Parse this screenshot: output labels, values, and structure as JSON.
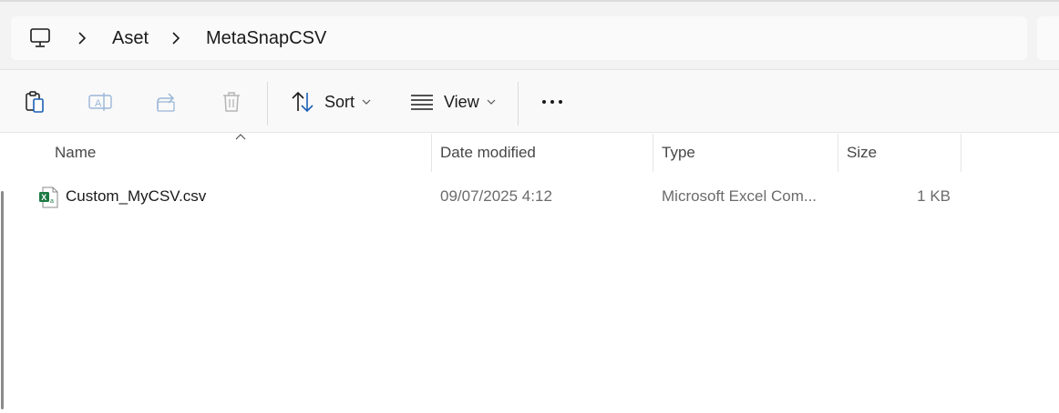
{
  "breadcrumb": {
    "items": [
      "Aset",
      "MetaSnapCSV"
    ]
  },
  "toolbar": {
    "sort_label": "Sort",
    "view_label": "View"
  },
  "columns": {
    "name": "Name",
    "date": "Date modified",
    "type": "Type",
    "size": "Size"
  },
  "files": [
    {
      "name": "Custom_MyCSV.csv",
      "date": "09/07/2025 4:12",
      "type": "Microsoft Excel Com...",
      "size": "1 KB",
      "icon": "excel-csv-icon"
    }
  ],
  "colors": {
    "excel_green": "#1d7a43",
    "accent_blue": "#1a5fb4"
  }
}
